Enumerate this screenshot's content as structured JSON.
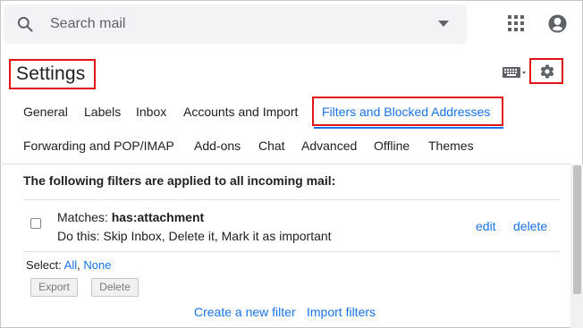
{
  "search": {
    "placeholder": "Search mail"
  },
  "header": {
    "title": "Settings"
  },
  "tabs_row1": [
    "General",
    "Labels",
    "Inbox",
    "Accounts and Import",
    "Filters and Blocked Addresses"
  ],
  "tabs_row2": [
    "Forwarding and POP/IMAP",
    "Add-ons",
    "Chat",
    "Advanced",
    "Offline",
    "Themes"
  ],
  "active_tab": "Filters and Blocked Addresses",
  "filters": {
    "heading": "The following filters are applied to all incoming mail:",
    "items": [
      {
        "matches_label": "Matches:",
        "matches_value": "has:attachment",
        "do_this": "Do this: Skip Inbox, Delete it, Mark it as important",
        "edit_label": "edit",
        "delete_label": "delete"
      }
    ],
    "select_label": "Select:",
    "select_all": "All",
    "select_separator": ",",
    "select_none": "None",
    "export_button": "Export",
    "delete_button": "Delete",
    "create_link": "Create a new filter",
    "import_link": "Import filters"
  },
  "colors": {
    "accent": "#1a73e8",
    "highlight_border": "#e0151a"
  },
  "icons": [
    "search-icon",
    "chevron-down-icon",
    "apps-grid-icon",
    "account-icon",
    "keyboard-icon",
    "gear-icon"
  ]
}
